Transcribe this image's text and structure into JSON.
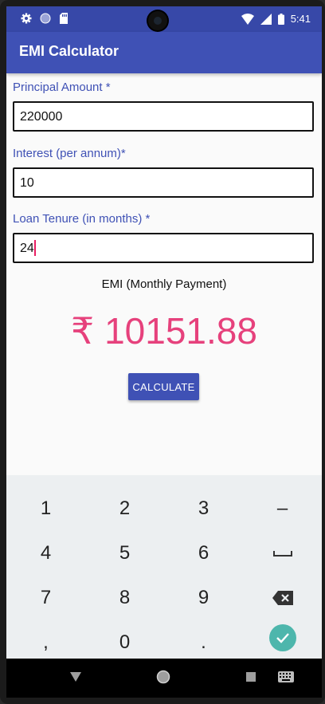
{
  "status_bar": {
    "time": "5:41",
    "left_icons": [
      "settings-icon",
      "circle-icon",
      "sd-card-icon"
    ],
    "right_icons": [
      "wifi-icon",
      "signal-icon",
      "battery-icon"
    ]
  },
  "app_bar": {
    "title": "EMI Calculator",
    "color": "#3f51b5"
  },
  "form": {
    "principal": {
      "label": "Principal Amount *",
      "value": "220000"
    },
    "interest": {
      "label": "Interest (per annum)*",
      "value": "10"
    },
    "tenure": {
      "label": "Loan Tenure (in months) *",
      "value": "24"
    }
  },
  "result": {
    "label": "EMI (Monthly Payment)",
    "value": "₹ 10151.88",
    "color": "#e6417c"
  },
  "calculate_button": {
    "label": "CALCULATE"
  },
  "keyboard": {
    "rows": [
      [
        "1",
        "2",
        "3",
        "–"
      ],
      [
        "4",
        "5",
        "6",
        "space"
      ],
      [
        "7",
        "8",
        "9",
        "backspace"
      ],
      [
        ",",
        "0",
        ".",
        "done"
      ]
    ]
  },
  "nav_bar": {
    "buttons": [
      "back-icon",
      "home-icon",
      "recents-icon",
      "keyboard-switch-icon"
    ]
  }
}
